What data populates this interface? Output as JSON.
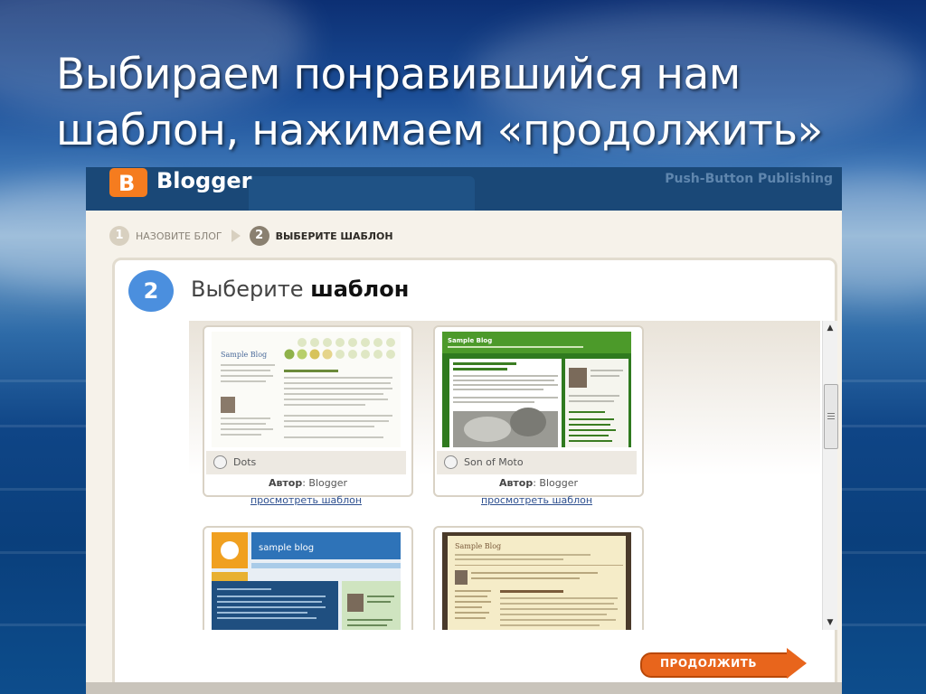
{
  "slide": {
    "title_line1": "Выбираем понравившийся нам",
    "title_line2": "шаблон, нажимаем «продолжить»"
  },
  "blogger": {
    "logo_letter": "B",
    "logo_text": "Blogger",
    "tagline": "Push-Button Publishing"
  },
  "steps": [
    {
      "number": "1",
      "label": "НАЗОВИТЕ БЛОГ",
      "active": false
    },
    {
      "number": "2",
      "label": "ВЫБЕРИТЕ ШАБЛОН",
      "active": true
    }
  ],
  "panel": {
    "number": "2",
    "heading_normal": "Выберите",
    "heading_bold": "шаблон"
  },
  "templates": [
    {
      "name": "Dots",
      "author_label": "Автор",
      "author": ": Blogger",
      "preview_link": "просмотреть шаблон",
      "thumb_title": "Sample Blog"
    },
    {
      "name": "Son of Moto",
      "author_label": "Автор",
      "author": ": Blogger",
      "preview_link": "просмотреть шаблон",
      "thumb_title": "Sample Blog"
    },
    {
      "name": "",
      "thumb_title": "sample blog"
    },
    {
      "name": "",
      "thumb_title": "Sample Blog"
    }
  ],
  "continue_button": "ПРОДОЛЖИТЬ",
  "colors": {
    "header": "#1a4877",
    "accent_orange": "#e8651c",
    "step_blue": "#4b8fde",
    "link": "#2d4f8f"
  }
}
